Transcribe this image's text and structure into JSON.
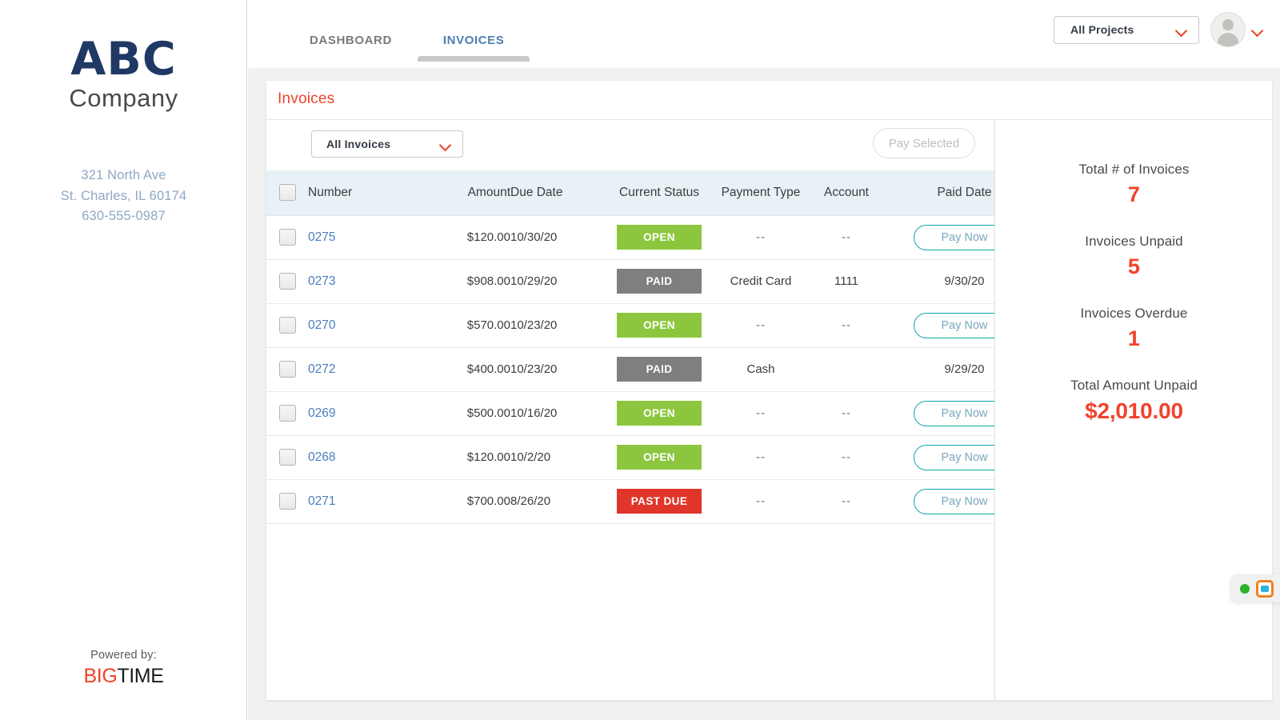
{
  "sidebar": {
    "logo_primary": "ABC",
    "logo_secondary": "Company",
    "address_line1": "321 North Ave",
    "address_line2": "St. Charles, IL 60174",
    "address_line3": "630-555-0987",
    "powered_label": "Powered by:",
    "powered_brand_first": "BIG",
    "powered_brand_second": "TIME"
  },
  "header": {
    "tabs": [
      {
        "label": "DASHBOARD",
        "active": false
      },
      {
        "label": "INVOICES",
        "active": true
      }
    ],
    "project_selector": {
      "value": "All Projects"
    },
    "avatar_alt": "user-avatar"
  },
  "card": {
    "title": "Invoices",
    "filter_selector": {
      "value": "All Invoices"
    },
    "pay_selected_label": "Pay Selected"
  },
  "table": {
    "columns": [
      {
        "key": "check",
        "label": ""
      },
      {
        "key": "number",
        "label": "Number"
      },
      {
        "key": "amount",
        "label": "Amount"
      },
      {
        "key": "due_date",
        "label": "Due Date"
      },
      {
        "key": "status",
        "label": "Current Status"
      },
      {
        "key": "payment_type",
        "label": "Payment Type"
      },
      {
        "key": "account",
        "label": "Account"
      },
      {
        "key": "paid_date",
        "label": "Paid Date"
      }
    ],
    "rows": [
      {
        "number": "0275",
        "amount": "$120.00",
        "due_date": "10/30/20",
        "status": "OPEN",
        "status_kind": "open",
        "payment_type": "--",
        "account": "--",
        "paid_date": "",
        "action_label": "Pay Now",
        "has_action": true
      },
      {
        "number": "0273",
        "amount": "$908.00",
        "due_date": "10/29/20",
        "status": "PAID",
        "status_kind": "paid",
        "payment_type": "Credit Card",
        "account": "1111",
        "paid_date": "9/30/20",
        "action_label": "",
        "has_action": false
      },
      {
        "number": "0270",
        "amount": "$570.00",
        "due_date": "10/23/20",
        "status": "OPEN",
        "status_kind": "open",
        "payment_type": "--",
        "account": "--",
        "paid_date": "",
        "action_label": "Pay Now",
        "has_action": true
      },
      {
        "number": "0272",
        "amount": "$400.00",
        "due_date": "10/23/20",
        "status": "PAID",
        "status_kind": "paid",
        "payment_type": "Cash",
        "account": "",
        "paid_date": "9/29/20",
        "action_label": "",
        "has_action": false
      },
      {
        "number": "0269",
        "amount": "$500.00",
        "due_date": "10/16/20",
        "status": "OPEN",
        "status_kind": "open",
        "payment_type": "--",
        "account": "--",
        "paid_date": "",
        "action_label": "Pay Now",
        "has_action": true
      },
      {
        "number": "0268",
        "amount": "$120.00",
        "due_date": "10/2/20",
        "status": "OPEN",
        "status_kind": "open",
        "payment_type": "--",
        "account": "--",
        "paid_date": "",
        "action_label": "Pay Now",
        "has_action": true
      },
      {
        "number": "0271",
        "amount": "$700.00",
        "due_date": "8/26/20",
        "status": "PAST DUE",
        "status_kind": "pastdue",
        "payment_type": "--",
        "account": "--",
        "paid_date": "",
        "action_label": "Pay Now",
        "has_action": true
      }
    ]
  },
  "summary": {
    "items": [
      {
        "label": "Total # of Invoices",
        "value": "7",
        "money": false
      },
      {
        "label": "Invoices Unpaid",
        "value": "5",
        "money": false
      },
      {
        "label": "Invoices Overdue",
        "value": "1",
        "money": false
      },
      {
        "label": "Total Amount Unpaid",
        "value": "$2,010.00",
        "money": true
      }
    ]
  },
  "widget": {
    "status": "online",
    "icon": "chat-icon"
  },
  "colors": {
    "accent_red": "#f0432b",
    "status_open": "#8cc63f",
    "status_paid": "#7f7f7f",
    "status_pastdue": "#e0352a",
    "link_blue": "#4a7dbd",
    "tab_active": "#4f7fb5",
    "pay_now_border": "#0fa5ad",
    "brand_navy": "#1f3864"
  }
}
